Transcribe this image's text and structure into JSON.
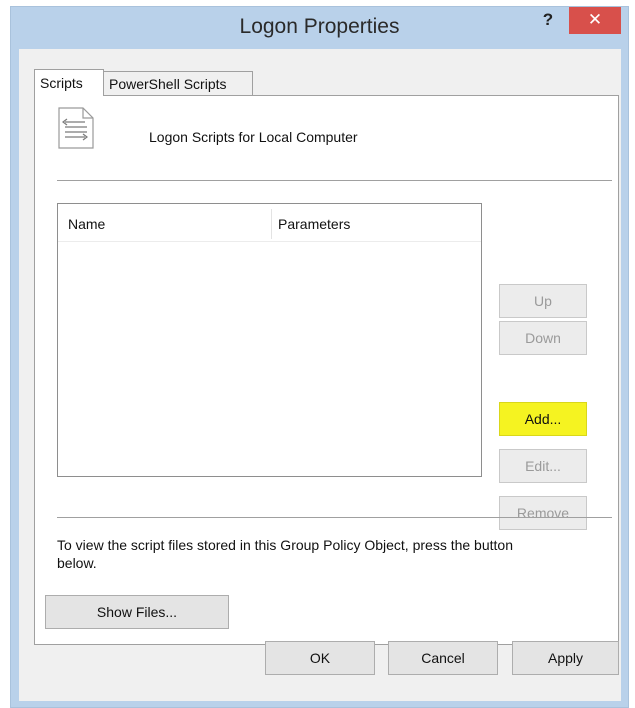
{
  "window": {
    "title": "Logon Properties",
    "help_label": "?",
    "close_label": "✕"
  },
  "tabs": [
    {
      "label": "Scripts",
      "selected": true
    },
    {
      "label": "PowerShell Scripts",
      "selected": false
    }
  ],
  "panel": {
    "heading": "Logon Scripts for Local Computer",
    "icon": "script-document-icon",
    "list": {
      "columns": [
        "Name",
        "Parameters"
      ],
      "rows": []
    },
    "buttons": {
      "up": "Up",
      "down": "Down",
      "add": "Add...",
      "edit": "Edit...",
      "remove": "Remove"
    },
    "info_text": "To view the script files stored in this Group Policy Object, press the button below.",
    "show_files": "Show Files..."
  },
  "footer": {
    "ok": "OK",
    "cancel": "Cancel",
    "apply": "Apply"
  },
  "colors": {
    "titlebar": "#b9d1ea",
    "close_button": "#d8504b",
    "highlight": "#f5f321"
  }
}
